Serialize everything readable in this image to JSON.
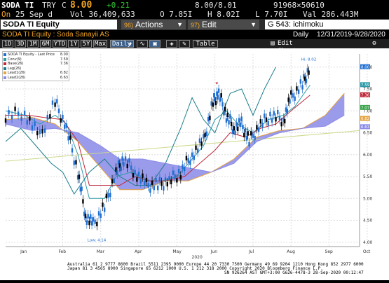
{
  "quote": {
    "ticker": "SODA TI",
    "currency": "TRY",
    "last_prefix": "C",
    "last": "8.00",
    "change": "+0.21",
    "bid_ask": "8.00/8.01",
    "bid_ask_size": "91968×50610",
    "open_label": "On",
    "date": "25 Sep d",
    "volume": "Vol 36,409,633",
    "open": "O 7.85I",
    "high": "H 8.02I",
    "low": "L 7.70I",
    "value": "Val 286.443M"
  },
  "toolbar": {
    "security": "SODA TI Equity",
    "actions_num": "96)",
    "actions": "Actions",
    "edit_num": "97)",
    "edit": "Edit",
    "page_title": "G 543: ichimoku"
  },
  "subheader": {
    "name": "SODA TI Equity : Soda Sanayii AS",
    "period": "Daily",
    "range": "12/31/2019-9/28/2020"
  },
  "ranges": [
    "1D",
    "3D",
    "1M",
    "6M",
    "YTD",
    "1Y",
    "5Y",
    "Max"
  ],
  "frequency": "Daily",
  "tools": {
    "table": "Table",
    "edit_chart": "Edit Chart"
  },
  "legend": [
    {
      "name": "SODA TI Equity - Last Price",
      "value": "8.00",
      "color": "#1f6fd1"
    },
    {
      "name": "Conv(9)",
      "value": "7.59",
      "color": "#2a9aa8"
    },
    {
      "name": "Base(26)",
      "value": "7.36",
      "color": "#c0283a"
    },
    {
      "name": "Lag(26)",
      "value": "",
      "color": "#1b7f8a"
    },
    {
      "name": "Lead1(26)",
      "value": "6.82",
      "color": "#e6a23c"
    },
    {
      "name": "Lead2(26)",
      "value": "6.63",
      "color": "#8a8ae8"
    }
  ],
  "annotations": {
    "high": "Hi: 8.02",
    "low": "Low: 4.14"
  },
  "chart_data": {
    "type": "line",
    "x_ticks": [
      "Jan",
      "Feb",
      "Mar",
      "Apr",
      "May",
      "Jun",
      "Jul",
      "Aug",
      "Sep",
      "Oct"
    ],
    "year_label": "2020",
    "y_ticks": [
      "4.00",
      "4.50",
      "5.00",
      "5.50",
      "6.00",
      "6.50",
      "7.00",
      "7.50",
      "8.00"
    ],
    "ylim": [
      3.9,
      8.3
    ],
    "price_tags": [
      {
        "label": "8.00",
        "color": "#1f6fd1"
      },
      {
        "label": "7.59",
        "color": "#2a9aa8"
      },
      {
        "label": "7.36",
        "color": "#c0283a"
      },
      {
        "label": "7.07",
        "color": "#3aa64a"
      },
      {
        "label": "6.82",
        "color": "#e6a23c"
      },
      {
        "label": "6.63",
        "color": "#8a8ae8"
      }
    ],
    "series": [
      {
        "name": "SODA TI Equity - Last Price",
        "points": [
          [
            0,
            6.9
          ],
          [
            0.5,
            6.95
          ],
          [
            0.9,
            6.4
          ],
          [
            1.3,
            7.2
          ],
          [
            1.6,
            6.6
          ],
          [
            1.9,
            5.6
          ],
          [
            2.1,
            4.6
          ],
          [
            2.3,
            4.4
          ],
          [
            2.6,
            4.8
          ],
          [
            2.9,
            5.6
          ],
          [
            3.1,
            5.9
          ],
          [
            3.4,
            5.6
          ],
          [
            3.7,
            5.3
          ],
          [
            4.0,
            5.3
          ],
          [
            4.3,
            5.4
          ],
          [
            4.6,
            5.6
          ],
          [
            4.9,
            6.0
          ],
          [
            5.2,
            6.3
          ],
          [
            5.45,
            7.2
          ],
          [
            5.6,
            7.4
          ],
          [
            5.8,
            6.9
          ],
          [
            6.0,
            6.6
          ],
          [
            6.2,
            6.7
          ],
          [
            6.4,
            6.3
          ],
          [
            6.7,
            6.7
          ],
          [
            7.0,
            6.9
          ],
          [
            7.3,
            6.8
          ],
          [
            7.5,
            7.3
          ],
          [
            7.8,
            7.6
          ],
          [
            8.0,
            8.0
          ]
        ]
      },
      {
        "name": "Conv(9)",
        "points": [
          [
            0,
            7.0
          ],
          [
            0.5,
            6.9
          ],
          [
            0.9,
            6.7
          ],
          [
            1.3,
            6.9
          ],
          [
            1.6,
            6.7
          ],
          [
            1.9,
            6.0
          ],
          [
            2.2,
            5.0
          ],
          [
            2.6,
            5.0
          ],
          [
            2.9,
            5.5
          ],
          [
            3.3,
            5.6
          ],
          [
            3.7,
            5.4
          ],
          [
            4.1,
            5.4
          ],
          [
            4.5,
            5.5
          ],
          [
            4.9,
            5.9
          ],
          [
            5.2,
            6.2
          ],
          [
            5.5,
            6.8
          ],
          [
            5.8,
            7.0
          ],
          [
            6.1,
            6.7
          ],
          [
            6.5,
            6.5
          ],
          [
            6.9,
            6.8
          ],
          [
            7.3,
            6.9
          ],
          [
            7.6,
            7.1
          ],
          [
            8.0,
            7.59
          ]
        ]
      },
      {
        "name": "Base(26)",
        "points": [
          [
            0,
            6.9
          ],
          [
            0.6,
            6.9
          ],
          [
            1.0,
            6.85
          ],
          [
            1.5,
            6.8
          ],
          [
            1.9,
            6.3
          ],
          [
            2.2,
            5.3
          ],
          [
            2.6,
            5.3
          ],
          [
            3.0,
            5.3
          ],
          [
            3.4,
            5.5
          ],
          [
            3.8,
            5.4
          ],
          [
            4.2,
            5.4
          ],
          [
            4.7,
            5.5
          ],
          [
            5.1,
            5.8
          ],
          [
            5.5,
            6.1
          ],
          [
            5.9,
            6.5
          ],
          [
            6.3,
            6.4
          ],
          [
            6.7,
            6.6
          ],
          [
            7.1,
            6.7
          ],
          [
            7.5,
            7.0
          ],
          [
            8.0,
            7.36
          ]
        ]
      },
      {
        "name": "Lag(26)",
        "points": [
          [
            0,
            6.3
          ],
          [
            0.4,
            6.6
          ],
          [
            0.8,
            6.2
          ],
          [
            1.2,
            5.8
          ],
          [
            1.5,
            5.6
          ],
          [
            1.8,
            5.1
          ],
          [
            2.2,
            5.6
          ],
          [
            2.6,
            5.9
          ],
          [
            3.0,
            5.5
          ],
          [
            3.4,
            5.3
          ],
          [
            3.8,
            5.3
          ],
          [
            4.2,
            5.8
          ],
          [
            4.6,
            6.6
          ],
          [
            4.9,
            7.3
          ],
          [
            5.2,
            6.8
          ],
          [
            5.5,
            6.5
          ],
          [
            5.9,
            7.4
          ],
          [
            6.2,
            7.5
          ],
          [
            6.5,
            6.9
          ],
          [
            6.8,
            7.5
          ],
          [
            7.1,
            8.0
          ]
        ]
      },
      {
        "name": "Lead1(26)",
        "points": [
          [
            0,
            6.8
          ],
          [
            0.7,
            6.85
          ],
          [
            1.3,
            6.7
          ],
          [
            1.9,
            6.3
          ],
          [
            2.5,
            5.7
          ],
          [
            3.0,
            5.2
          ],
          [
            3.6,
            5.2
          ],
          [
            4.2,
            5.4
          ],
          [
            4.8,
            5.4
          ],
          [
            5.4,
            5.6
          ],
          [
            6.0,
            5.9
          ],
          [
            6.6,
            6.4
          ],
          [
            7.2,
            6.55
          ],
          [
            7.8,
            6.6
          ],
          [
            8.4,
            6.9
          ],
          [
            8.9,
            7.4
          ]
        ]
      },
      {
        "name": "Lead2(26)",
        "points": [
          [
            0,
            6.7
          ],
          [
            0.7,
            6.55
          ],
          [
            1.3,
            6.6
          ],
          [
            1.9,
            6.5
          ],
          [
            2.5,
            6.2
          ],
          [
            3.0,
            5.9
          ],
          [
            3.6,
            5.9
          ],
          [
            4.2,
            5.8
          ],
          [
            4.8,
            5.7
          ],
          [
            5.4,
            5.6
          ],
          [
            6.0,
            5.8
          ],
          [
            6.6,
            6.3
          ],
          [
            7.2,
            6.5
          ],
          [
            7.8,
            6.6
          ],
          [
            8.4,
            6.65
          ],
          [
            8.9,
            6.9
          ]
        ]
      }
    ]
  },
  "footer": {
    "line1": "Australia 61 2 9777 8600 Brazil 5511 2395 9000 Europe 44 20 7330 7500 Germany 49 69 9204 1210 Hong Kong 852 2977 6000",
    "line2": "Japan 81 3 4565 8900        Singapore 65 6212 1000       U.S. 1 212 318 2000          Copyright 2020 Bloomberg Finance L.P.",
    "line3": "SN 926264 AST  GMT+3:00 G626-4478-3 28-Sep-2020 00:12:47"
  }
}
